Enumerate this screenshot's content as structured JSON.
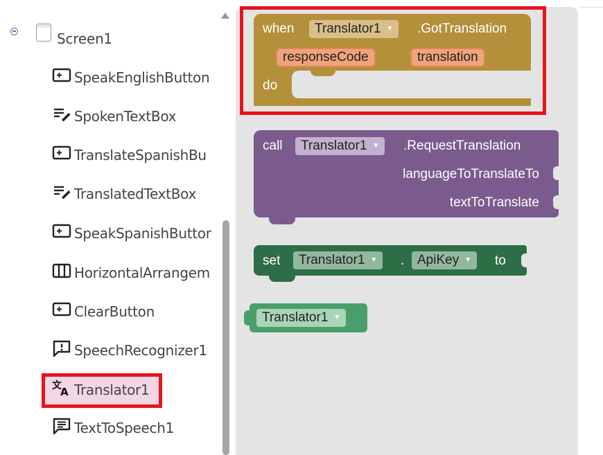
{
  "tree": {
    "screen": {
      "label": "Screen1",
      "icon": "screen-icon"
    },
    "items": [
      {
        "label": "SpeakEnglishButton",
        "icon": "button-icon"
      },
      {
        "label": "SpokenTextBox",
        "icon": "textbox-icon"
      },
      {
        "label": "TranslateSpanishBu",
        "icon": "button-icon"
      },
      {
        "label": "TranslatedTextBox",
        "icon": "textbox-icon"
      },
      {
        "label": "SpeakSpanishButtor",
        "icon": "button-icon"
      },
      {
        "label": "HorizontalArrangem",
        "icon": "horizontal-arrangement-icon"
      },
      {
        "label": "ClearButton",
        "icon": "button-icon"
      },
      {
        "label": "SpeechRecognizer1",
        "icon": "speech-recognizer-icon"
      },
      {
        "label": "Translator1",
        "icon": "translator-icon",
        "selected": true
      },
      {
        "label": "TextToSpeech1",
        "icon": "text-to-speech-icon"
      }
    ]
  },
  "blocks": {
    "event": {
      "when": "when",
      "component": "Translator1",
      "event": ".GotTranslation",
      "params": [
        "responseCode",
        "translation"
      ],
      "do": "do",
      "color": "#b5903a"
    },
    "call": {
      "call": "call",
      "component": "Translator1",
      "method": ".RequestTranslation",
      "args": [
        "languageToTranslateTo",
        "textToTranslate"
      ],
      "color": "#7b5b8d"
    },
    "set": {
      "set": "set",
      "component": "Translator1",
      "dot": ".",
      "property": "ApiKey",
      "to": "to",
      "color": "#2e6e47"
    },
    "component": {
      "label": "Translator1",
      "color": "#4a9e6b"
    }
  },
  "colors": {
    "highlight": "#e8141c",
    "workspace": "#e4e4e4",
    "selected_bg": "#f3d6e4"
  }
}
